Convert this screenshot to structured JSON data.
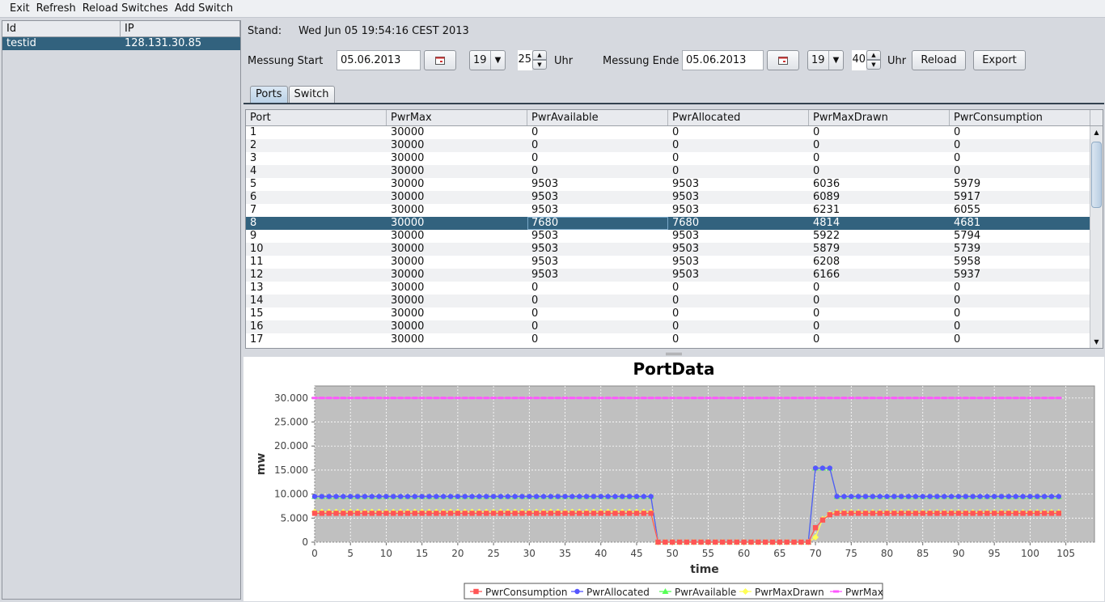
{
  "menu": [
    "Exit",
    "Refresh",
    "Reload Switches",
    "Add Switch"
  ],
  "switch_table": {
    "columns": [
      "Id",
      "IP"
    ],
    "rows": [
      {
        "id": "testid",
        "ip": "128.131.30.85"
      }
    ]
  },
  "stand": {
    "label": "Stand:",
    "value": "Wed Jun 05 19:54:16 CEST 2013"
  },
  "start": {
    "label": "Messung Start",
    "date": "05.06.2013",
    "hour": "19",
    "minute": "25",
    "unit": "Uhr"
  },
  "end": {
    "label": "Messung Ende",
    "date": "05.06.2013",
    "hour": "19",
    "minute": "40",
    "unit": "Uhr"
  },
  "buttons": {
    "reload": "Reload",
    "export": "Export"
  },
  "tabs": [
    "Ports",
    "Switch"
  ],
  "ports_table": {
    "columns": [
      "Port",
      "PwrMax",
      "PwrAvailable",
      "PwrAllocated",
      "PwrMaxDrawn",
      "PwrConsumption"
    ],
    "rows": [
      [
        "1",
        "30000",
        "0",
        "0",
        "0",
        "0"
      ],
      [
        "2",
        "30000",
        "0",
        "0",
        "0",
        "0"
      ],
      [
        "3",
        "30000",
        "0",
        "0",
        "0",
        "0"
      ],
      [
        "4",
        "30000",
        "0",
        "0",
        "0",
        "0"
      ],
      [
        "5",
        "30000",
        "9503",
        "9503",
        "6036",
        "5979"
      ],
      [
        "6",
        "30000",
        "9503",
        "9503",
        "6089",
        "5917"
      ],
      [
        "7",
        "30000",
        "9503",
        "9503",
        "6231",
        "6055"
      ],
      [
        "8",
        "30000",
        "7680",
        "7680",
        "4814",
        "4681"
      ],
      [
        "9",
        "30000",
        "9503",
        "9503",
        "5922",
        "5794"
      ],
      [
        "10",
        "30000",
        "9503",
        "9503",
        "5879",
        "5739"
      ],
      [
        "11",
        "30000",
        "9503",
        "9503",
        "6208",
        "5958"
      ],
      [
        "12",
        "30000",
        "9503",
        "9503",
        "6166",
        "5937"
      ],
      [
        "13",
        "30000",
        "0",
        "0",
        "0",
        "0"
      ],
      [
        "14",
        "30000",
        "0",
        "0",
        "0",
        "0"
      ],
      [
        "15",
        "30000",
        "0",
        "0",
        "0",
        "0"
      ],
      [
        "16",
        "30000",
        "0",
        "0",
        "0",
        "0"
      ],
      [
        "17",
        "30000",
        "0",
        "0",
        "0",
        "0"
      ]
    ],
    "selected_row": 7
  },
  "colors": {
    "selection": "#32627e",
    "plot_bg": "#c0c0c0",
    "PwrConsumption": "#ff5555",
    "PwrAllocated": "#5555ff",
    "PwrAvailable": "#55ff55",
    "PwrMaxDrawn": "#ffff55",
    "PwrMax": "#ff55ff"
  },
  "chart_data": {
    "type": "line",
    "title": "PortData",
    "xlabel": "time",
    "ylabel": "mw",
    "xlim": [
      0,
      109
    ],
    "ylim": [
      0,
      32500
    ],
    "xticks": [
      0,
      5,
      10,
      15,
      20,
      25,
      30,
      35,
      40,
      45,
      50,
      55,
      60,
      65,
      70,
      75,
      80,
      85,
      90,
      95,
      100,
      105
    ],
    "yticks": [
      0,
      5000,
      10000,
      15000,
      20000,
      25000,
      30000
    ],
    "ytick_labels": [
      "0",
      "5.000",
      "10.000",
      "15.000",
      "20.000",
      "25.000",
      "30.000"
    ],
    "grid": true,
    "legend_position": "bottom",
    "series": [
      {
        "name": "PwrConsumption",
        "marker": "square",
        "segments": [
          {
            "x_from": 0,
            "x_to": 47,
            "y": 6000
          },
          {
            "x_from": 48,
            "x_to": 69,
            "y": 0
          },
          {
            "points": [
              [
                70,
                3000
              ],
              [
                71,
                4600
              ],
              [
                72,
                5700
              ],
              [
                73,
                6000
              ]
            ]
          },
          {
            "x_from": 74,
            "x_to": 104,
            "y": 6000
          }
        ]
      },
      {
        "name": "PwrAllocated",
        "marker": "circle",
        "segments": [
          {
            "x_from": 0,
            "x_to": 47,
            "y": 9503
          },
          {
            "x_from": 48,
            "x_to": 69,
            "y": 0
          },
          {
            "points": [
              [
                70,
                15400
              ],
              [
                71,
                15400
              ],
              [
                72,
                15400
              ]
            ]
          },
          {
            "x_from": 73,
            "x_to": 104,
            "y": 9503
          }
        ]
      },
      {
        "name": "PwrAvailable",
        "marker": "triangle",
        "segments": [
          {
            "x_from": 0,
            "x_to": 47,
            "y": 9503
          },
          {
            "x_from": 48,
            "x_to": 69,
            "y": 0
          },
          {
            "points": [
              [
                70,
                15400
              ],
              [
                71,
                15400
              ],
              [
                72,
                15400
              ]
            ]
          },
          {
            "x_from": 73,
            "x_to": 104,
            "y": 9503
          }
        ]
      },
      {
        "name": "PwrMaxDrawn",
        "marker": "diamond",
        "segments": [
          {
            "x_from": 0,
            "x_to": 47,
            "y": 6300
          },
          {
            "x_from": 48,
            "x_to": 69,
            "y": 0
          },
          {
            "points": [
              [
                70,
                1000
              ],
              [
                71,
                4800
              ],
              [
                72,
                5900
              ],
              [
                73,
                6200
              ]
            ]
          },
          {
            "x_from": 74,
            "x_to": 104,
            "y": 6200
          }
        ]
      },
      {
        "name": "PwrMax",
        "marker": "rect",
        "segments": [
          {
            "x_from": 0,
            "x_to": 104,
            "y": 30000
          }
        ]
      }
    ]
  }
}
